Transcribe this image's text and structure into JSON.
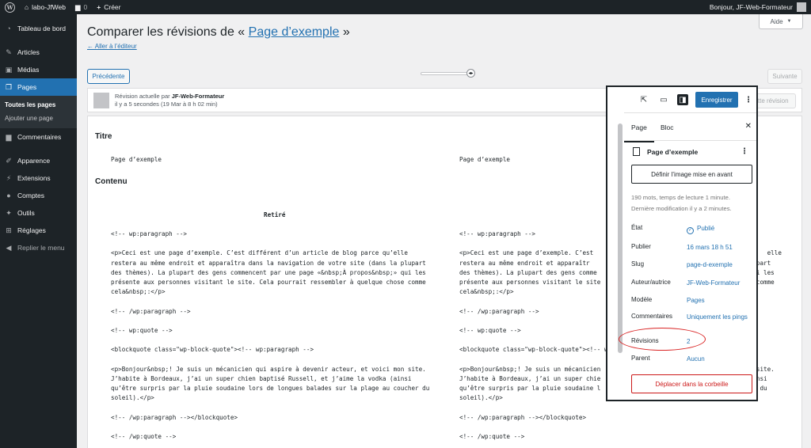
{
  "admin_bar": {
    "site_name": "labo-JfWeb",
    "comments_count": "0",
    "new_label": "Créer",
    "greeting": "Bonjour, JF-Web-Formateur"
  },
  "sidebar": {
    "items": [
      {
        "label": "Tableau de bord",
        "icon": "dashboard-icon"
      },
      {
        "label": "Articles",
        "icon": "pin-icon"
      },
      {
        "label": "Médias",
        "icon": "media-icon"
      },
      {
        "label": "Pages",
        "icon": "pages-icon"
      },
      {
        "label": "Commentaires",
        "icon": "comments-icon"
      },
      {
        "label": "Apparence",
        "icon": "brush-icon"
      },
      {
        "label": "Extensions",
        "icon": "plugin-icon"
      },
      {
        "label": "Comptes",
        "icon": "users-icon"
      },
      {
        "label": "Outils",
        "icon": "wrench-icon"
      },
      {
        "label": "Réglages",
        "icon": "settings-icon"
      },
      {
        "label": "Replier le menu",
        "icon": "collapse-icon"
      }
    ],
    "submenu": [
      "Toutes les pages",
      "Ajouter une page"
    ]
  },
  "header": {
    "help_label": "Aide",
    "title_prefix": "Comparer les révisions de «",
    "title_link": "Page d’exemple",
    "title_suffix": "»",
    "back_link": "← Aller à l’éditeur"
  },
  "revisions": {
    "prev_label": "Précédente",
    "next_label": "Suivante",
    "meta_line1_prefix": "Révision actuelle par",
    "meta_author": "JF-Web-Formateur",
    "meta_line2": "il y a 5 secondes (19 Mar à 8 h 02 min)",
    "restore_label": "ette révision"
  },
  "diff": {
    "title_heading": "Titre",
    "title_left": "Page d’exemple",
    "title_right": "Page d’exemple",
    "content_heading": "Contenu",
    "removed_label": "Retiré",
    "left_lines": [
      "<!-- wp:paragraph -->",
      "",
      "<p>Ceci est une page d’exemple. C’est différent d’un article de blog parce qu’elle",
      "restera au même endroit et apparaîtra dans la navigation de votre site (dans la plupart",
      "des thèmes). La plupart des gens commencent par une page «&nbsp;À propos&nbsp;» qui les",
      "présente aux personnes visitant le site. Cela pourrait ressembler à quelque chose comme",
      "cela&nbsp;:</p>",
      "",
      "<!-- /wp:paragraph -->",
      "",
      "<!-- wp:quote -->",
      "",
      "<blockquote class=\"wp-block-quote\"><!-- wp:paragraph -->",
      "",
      "<p>Bonjour&nbsp;! Je suis un mécanicien qui aspire à devenir acteur, et voici mon site.",
      "J’habite à Bordeaux, j’ai un super chien baptisé Russell, et j’aime la vodka (ainsi",
      "qu’être surpris par la pluie soudaine lors de longues balades sur la plage au coucher du",
      "soleil).</p>",
      "",
      "<!-- /wp:paragraph --></blockquote>",
      "",
      "<!-- /wp:quote -->",
      "",
      "<!-- wp:paragraph -->"
    ],
    "right_lines": [
      "<!-- wp:paragraph -->",
      "",
      "<p>Ceci est une page d’exemple. C’est                                                elle",
      "restera au même endroit et apparaîtr                                           plupart",
      "des thèmes). La plupart des gens comme                                          qui les",
      "présente aux personnes visitant le site                                        se comme",
      "cela&nbsp;:</p>",
      "",
      "<!-- /wp:paragraph -->",
      "",
      "<!-- wp:quote -->",
      "",
      "<blockquote class=\"wp-block-quote\"><!-- wp:paragraph -->",
      "",
      "<p>Bonjour&nbsp;! Je suis un mécanicien                                        on site.",
      "J’habite à Bordeaux, j’ai un super chie                                          insi",
      "qu’être surpris par la pluie soudaine l                                      ucher du",
      "soleil).</p>",
      "",
      "<!-- /wp:paragraph --></blockquote>",
      "",
      "<!-- /wp:quote -->",
      "",
      "<!-- wp:paragraph -->"
    ]
  },
  "editor_panel": {
    "save_label": "Enregistrer",
    "tab_page": "Page",
    "tab_block": "Bloc",
    "doc_title": "Page d’exemple",
    "featured_label": "Définir l’image mise en avant",
    "info_line1": "190 mots, temps de lecture 1 minute.",
    "info_line2": "Dernière modification il y a 2 minutes.",
    "rows": [
      {
        "label": "État",
        "value": "Publié"
      },
      {
        "label": "Publier",
        "value": "16 mars 18 h 51"
      },
      {
        "label": "Slug",
        "value": "page-d-exemple"
      },
      {
        "label": "Auteur/autrice",
        "value": "JF-Web-Formateur"
      },
      {
        "label": "Modèle",
        "value": "Pages"
      },
      {
        "label": "Commentaires",
        "value": "Uniquement les pings"
      },
      {
        "label": "Révisions",
        "value": "2"
      },
      {
        "label": "Parent",
        "value": "Aucun"
      }
    ],
    "trash_label": "Déplacer dans la corbeille"
  },
  "colors": {
    "admin_dark": "#1d2327",
    "accent": "#2271b1",
    "danger": "#cc1818",
    "annotation": "#d92323"
  }
}
